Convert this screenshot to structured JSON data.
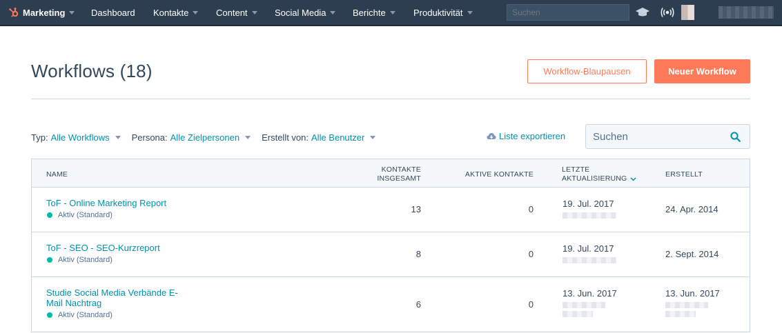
{
  "nav": {
    "brand": "Marketing",
    "items": [
      {
        "label": "Dashboard",
        "caret": false
      },
      {
        "label": "Kontakte",
        "caret": true
      },
      {
        "label": "Content",
        "caret": true
      },
      {
        "label": "Social Media",
        "caret": true
      },
      {
        "label": "Berichte",
        "caret": true
      },
      {
        "label": "Produktivität",
        "caret": true
      }
    ],
    "search_placeholder": "Suchen",
    "icons": [
      "academy-icon",
      "notifications-broadcast-icon"
    ],
    "accent": "#ff7a59",
    "bg": "#2d3e50"
  },
  "header": {
    "title": "Workflows (18)",
    "blueprints_label": "Workflow-Blaupausen",
    "new_label": "Neuer Workflow"
  },
  "filters": {
    "type": {
      "label": "Typ:",
      "value": "Alle Workflows"
    },
    "persona": {
      "label": "Persona:",
      "value": "Alle Zielpersonen"
    },
    "created_by": {
      "label": "Erstellt von:",
      "value": "Alle Benutzer"
    },
    "export_label": "Liste exportieren",
    "search_placeholder": "Suchen"
  },
  "table": {
    "columns": {
      "name": "NAME",
      "total_1": "KONTAKTE",
      "total_2": "INSGESAMT",
      "active": "AKTIVE KONTAKTE",
      "updated_1": "LETZTE",
      "updated_2": "AKTUALISIERUNG",
      "created": "ERSTELLT"
    },
    "sort_column": "updated",
    "rows": [
      {
        "name": "ToF - Online Marketing Report",
        "status": "Aktiv (Standard)",
        "total": "13",
        "active": "0",
        "updated": "19. Jul. 2017",
        "created": "24. Apr. 2014"
      },
      {
        "name": "ToF - SEO - SEO-Kurzreport",
        "status": "Aktiv (Standard)",
        "total": "8",
        "active": "0",
        "updated": "19. Jul. 2017",
        "created": "2. Sept. 2014"
      },
      {
        "name": "Studie Social Media Verbände E-Mail Nachtrag",
        "status": "Aktiv (Standard)",
        "total": "6",
        "active": "0",
        "updated": "13. Jun. 2017",
        "created": "13. Jun. 2017"
      }
    ],
    "status_color": "#00bda5",
    "link_color": "#0091ae"
  }
}
